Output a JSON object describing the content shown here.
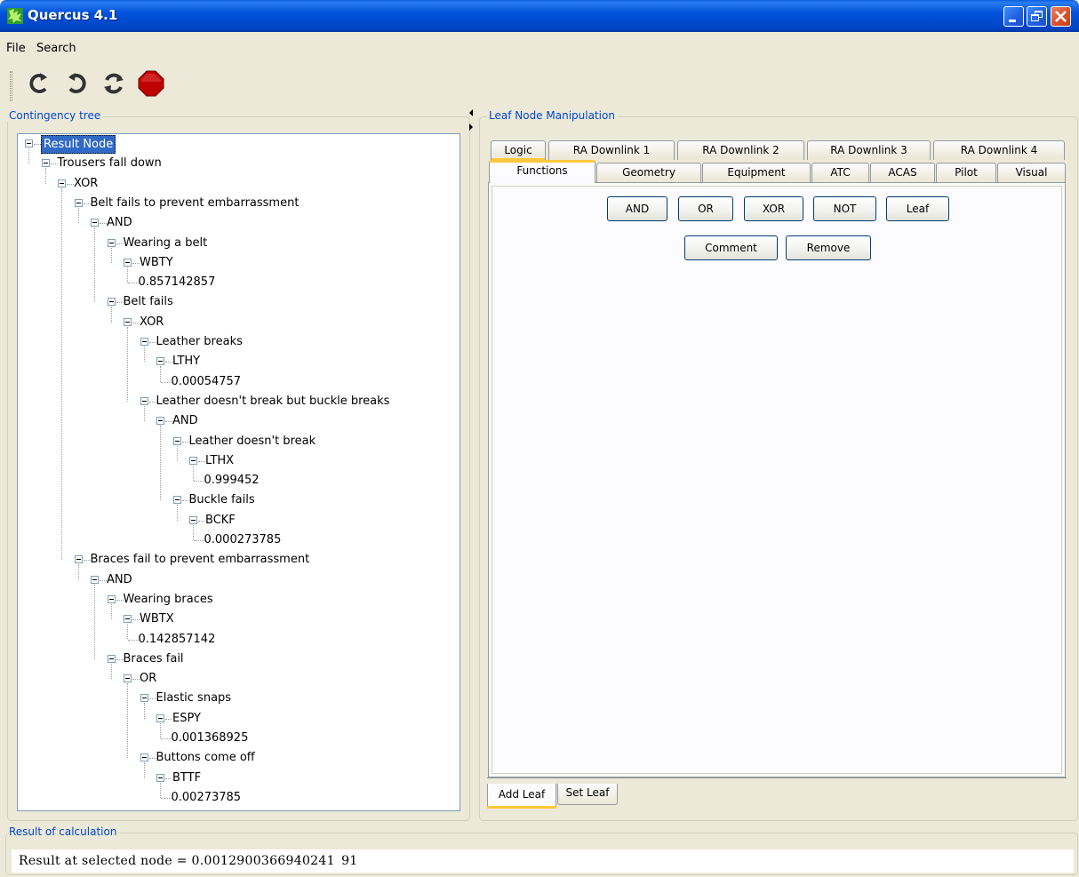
{
  "window": {
    "title": "Quercus 4.1"
  },
  "menu": [
    "File",
    "Search"
  ],
  "toolbar": [
    {
      "icon": "rotate-ccw-icon"
    },
    {
      "icon": "rotate-cw-icon"
    },
    {
      "icon": "refresh-both-icon"
    },
    {
      "icon": "stop-icon"
    }
  ],
  "tree_panel": {
    "title": "Contingency tree",
    "nodes": [
      {
        "label": "Result Node",
        "depth": 0,
        "selected": true
      },
      {
        "label": "Trousers fall down",
        "depth": 1
      },
      {
        "label": "XOR",
        "depth": 2
      },
      {
        "label": "Belt fails to prevent embarrassment",
        "depth": 3
      },
      {
        "label": "AND",
        "depth": 4
      },
      {
        "label": "Wearing a belt",
        "depth": 5
      },
      {
        "label": "WBTY",
        "depth": 6
      },
      {
        "label": "0.857142857",
        "depth": 7,
        "leaf": true
      },
      {
        "label": "Belt fails",
        "depth": 5
      },
      {
        "label": "XOR",
        "depth": 6
      },
      {
        "label": "Leather breaks",
        "depth": 7
      },
      {
        "label": "LTHY",
        "depth": 8
      },
      {
        "label": "0.00054757",
        "depth": 9,
        "leaf": true
      },
      {
        "label": "Leather doesn't break but buckle breaks",
        "depth": 7
      },
      {
        "label": "AND",
        "depth": 8
      },
      {
        "label": "Leather doesn't break",
        "depth": 9
      },
      {
        "label": "LTHX",
        "depth": 10
      },
      {
        "label": "0.999452",
        "depth": 11,
        "leaf": true
      },
      {
        "label": "Buckle fails",
        "depth": 9
      },
      {
        "label": "BCKF",
        "depth": 10
      },
      {
        "label": "0.000273785",
        "depth": 11,
        "leaf": true
      },
      {
        "label": "Braces fail to prevent embarrassment",
        "depth": 3
      },
      {
        "label": "AND",
        "depth": 4
      },
      {
        "label": "Wearing braces",
        "depth": 5
      },
      {
        "label": "WBTX",
        "depth": 6
      },
      {
        "label": "0.142857142",
        "depth": 7,
        "leaf": true
      },
      {
        "label": "Braces fail",
        "depth": 5
      },
      {
        "label": "OR",
        "depth": 6
      },
      {
        "label": "Elastic snaps",
        "depth": 7
      },
      {
        "label": "ESPY",
        "depth": 8
      },
      {
        "label": "0.001368925",
        "depth": 9,
        "leaf": true
      },
      {
        "label": "Buttons come off",
        "depth": 7
      },
      {
        "label": "BTTF",
        "depth": 8
      },
      {
        "label": "0.00273785",
        "depth": 9,
        "leaf": true
      }
    ]
  },
  "leaf_panel": {
    "title": "Leaf Node Manipulation",
    "tabs_row1": [
      "Logic",
      "RA Downlink 1",
      "RA Downlink 2",
      "RA Downlink 3",
      "RA Downlink 4"
    ],
    "tabs_row2": [
      "Functions",
      "Geometry",
      "Equipment",
      "ATC",
      "ACAS",
      "Pilot",
      "Visual"
    ],
    "active_tab": "Functions",
    "buttons_row1": [
      "AND",
      "OR",
      "XOR",
      "NOT",
      "Leaf"
    ],
    "buttons_row2": [
      "Comment",
      "Remove"
    ],
    "bottom_tabs": [
      "Add Leaf",
      "Set Leaf"
    ],
    "active_bottom_tab": "Add Leaf"
  },
  "result": {
    "title": "Result of calculation",
    "text": "Result at selected node = 0.0012900366940241 91"
  }
}
